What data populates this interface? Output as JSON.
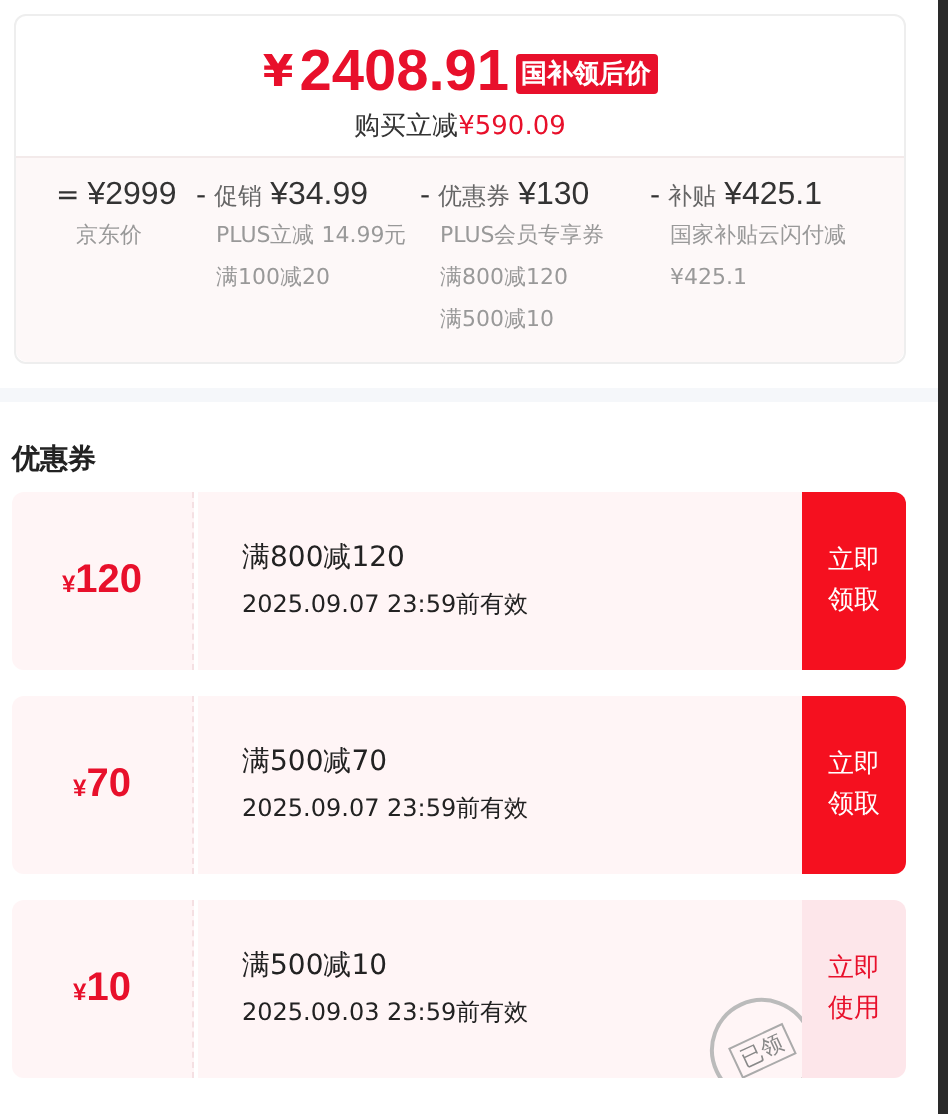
{
  "price_card": {
    "currency": "¥",
    "final_price": "2408.91",
    "price_badge": "国补领后价",
    "saving_label": "购买立减",
    "saving_amount": "¥590.09",
    "breakdown": [
      {
        "operator": "=",
        "amount": "¥2999",
        "notes": [
          "京东价"
        ]
      },
      {
        "operator": "-",
        "label": "促销",
        "amount": "¥34.99",
        "notes": [
          "PLUS立减 14.99元",
          "满100减20"
        ]
      },
      {
        "operator": "-",
        "label": "优惠券",
        "amount": "¥130",
        "notes": [
          "PLUS会员专享券",
          "满800减120",
          "满500减10"
        ]
      },
      {
        "operator": "-",
        "label": "补贴",
        "amount": "¥425.1",
        "notes": [
          "国家补贴云闪付减",
          "¥425.1"
        ]
      }
    ]
  },
  "coupons_section": {
    "title": "优惠券",
    "coupons": [
      {
        "currency": "¥",
        "value": "120",
        "condition": "满800减120",
        "validity": "2025.09.07 23:59前有效",
        "action": "立即领取",
        "claimed": false
      },
      {
        "currency": "¥",
        "value": "70",
        "condition": "满500减70",
        "validity": "2025.09.07 23:59前有效",
        "action": "立即领取",
        "claimed": false
      },
      {
        "currency": "¥",
        "value": "10",
        "condition": "满500减10",
        "validity": "2025.09.03 23:59前有效",
        "action": "立即使用",
        "claimed": true,
        "stamp": "已领"
      }
    ]
  }
}
